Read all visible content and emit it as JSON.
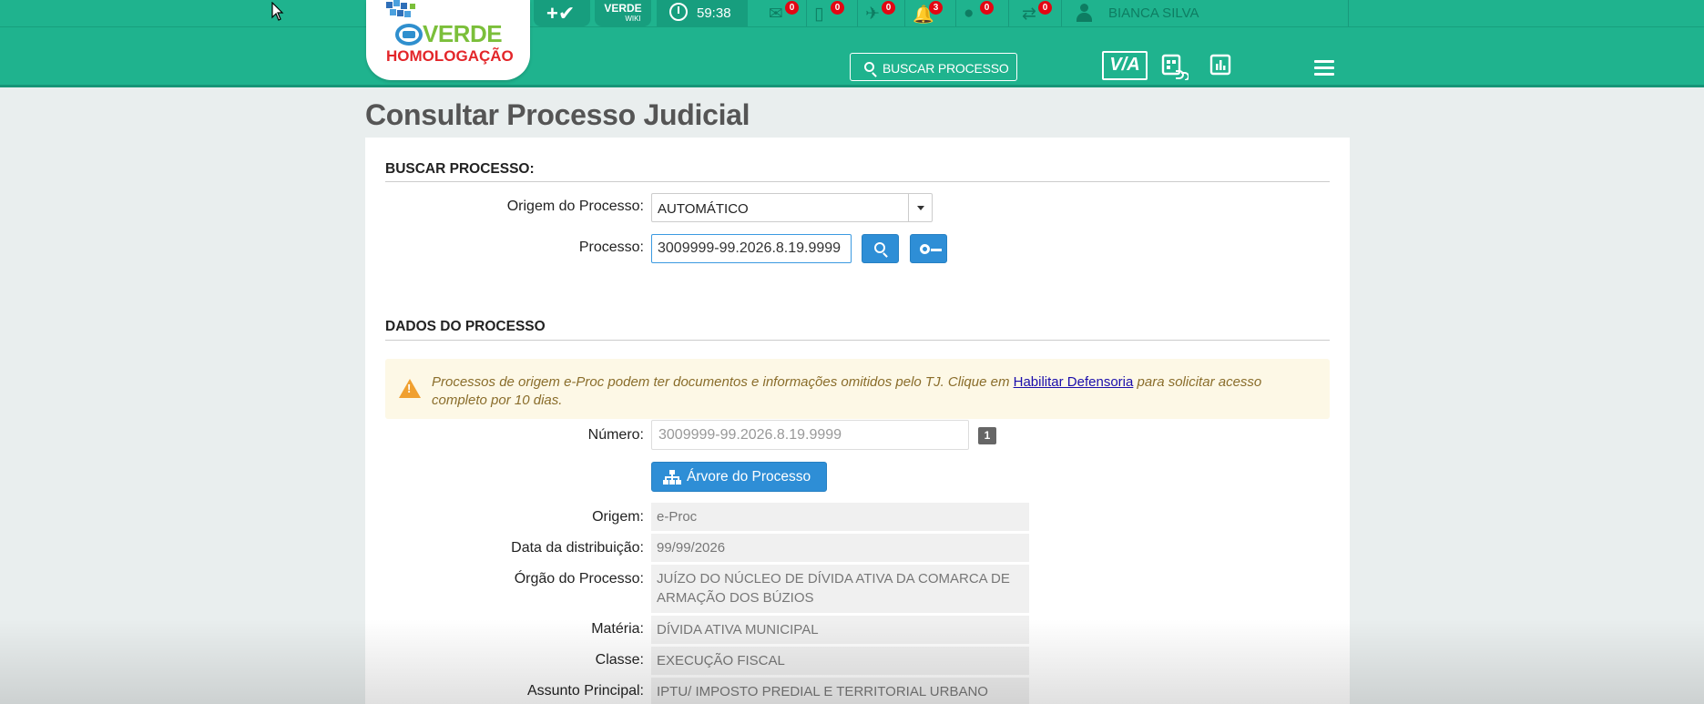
{
  "header": {
    "brand": "VERDE",
    "environment": "HOMOLOGAÇÃO",
    "wiki_label": "VERDE",
    "wiki_sub": "WIKI",
    "timer": "59:38",
    "notifications": [
      {
        "icon": "envelope-icon",
        "count": "0"
      },
      {
        "icon": "phone-icon",
        "count": "0"
      },
      {
        "icon": "pin-icon",
        "count": "0"
      },
      {
        "icon": "bell-icon",
        "count": "3"
      },
      {
        "icon": "chat-icon",
        "count": "0"
      },
      {
        "icon": "transfer-icon",
        "count": "0"
      }
    ],
    "user_name": "BIANCA SILVA",
    "search_label": "BUSCAR PROCESSO",
    "via_label": "V/A"
  },
  "page": {
    "title": "Consultar Processo Judicial"
  },
  "search_section": {
    "heading": "BUSCAR PROCESSO:",
    "origin_label": "Origem do Processo:",
    "origin_value": "AUTOMÁTICO",
    "process_label": "Processo:",
    "process_value": "3009999-99.2026.8.19.9999"
  },
  "data_section": {
    "heading": "DADOS DO PROCESSO",
    "alert_text_before": "Processos de origem e-Proc podem ter documentos e informações omitidos pelo TJ. Clique em ",
    "alert_link": "Habilitar Defensoria",
    "alert_text_after": " para solicitar acesso completo por 10 dias.",
    "number_label": "Número:",
    "number_value": "3009999-99.2026.8.19.9999",
    "number_badge": "1",
    "tree_button": "Árvore do Processo",
    "fields": [
      {
        "label": "Origem:",
        "value": "e-Proc"
      },
      {
        "label": "Data da distribuição:",
        "value": "99/99/2026"
      },
      {
        "label": "Órgão do Processo:",
        "value": "JUÍZO DO NÚCLEO DE DÍVIDA ATIVA DA COMARCA DE ARMAÇÃO DOS BÚZIOS"
      },
      {
        "label": "Matéria:",
        "value": "DÍVIDA ATIVA MUNICIPAL"
      },
      {
        "label": "Classe:",
        "value": "EXECUÇÃO FISCAL"
      },
      {
        "label": "Assunto Principal:",
        "value": "IPTU/ IMPOSTO PREDIAL E TERRITORIAL URBANO"
      }
    ]
  },
  "colors": {
    "header_green": "#1fb38e",
    "primary_blue": "#2e8ed6",
    "badge_red": "#e30613"
  }
}
